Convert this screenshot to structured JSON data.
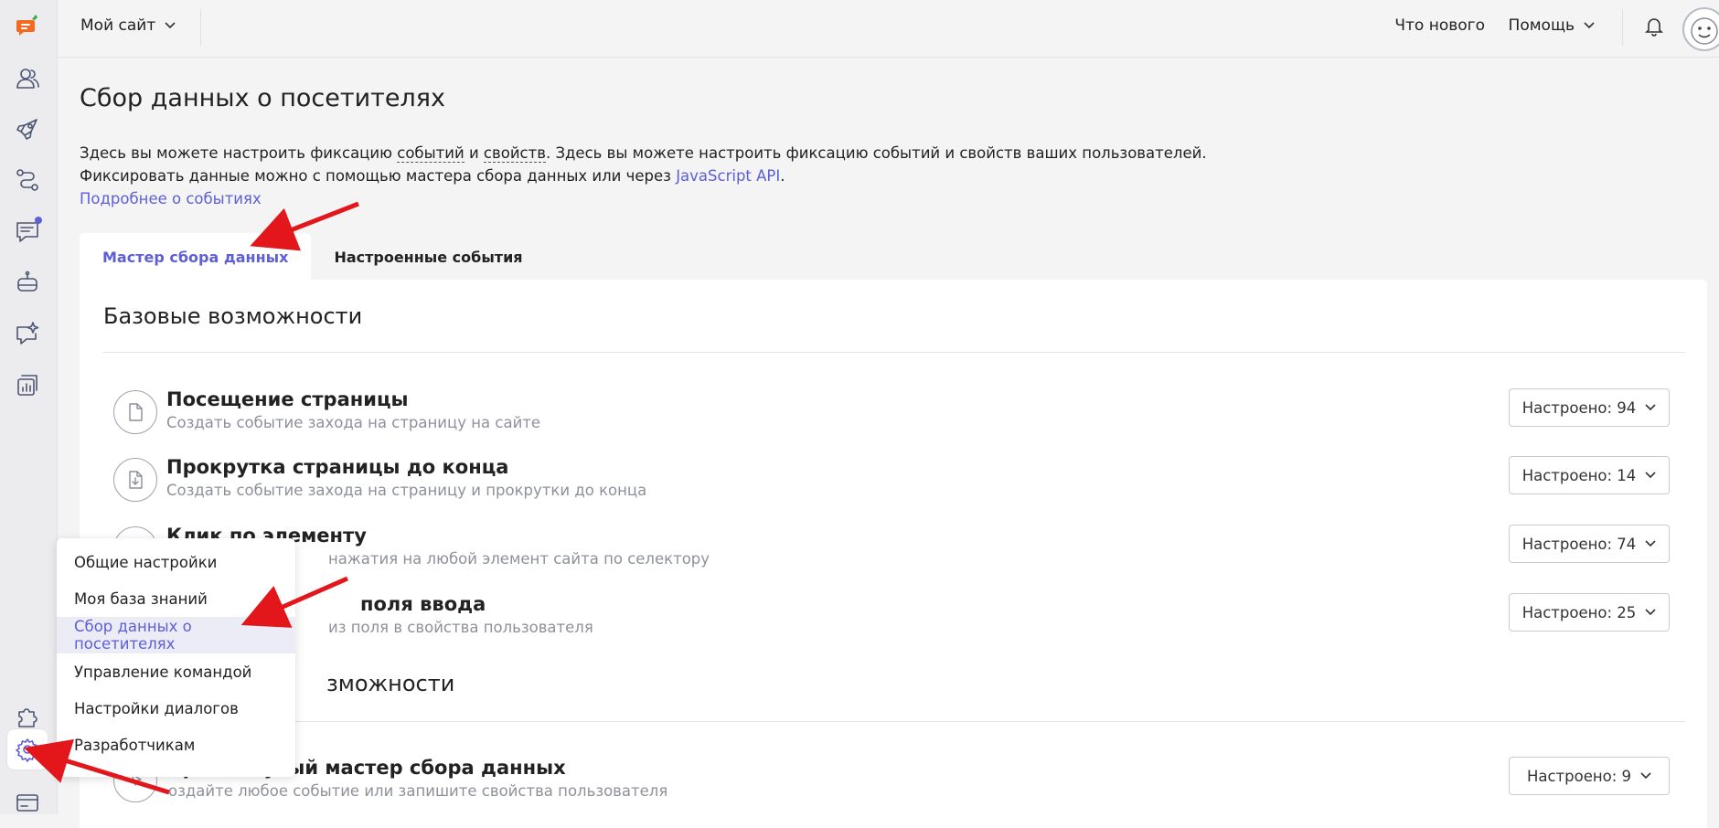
{
  "topbar": {
    "site_select": "Мой сайт",
    "whats_new": "Что нового",
    "help": "Помощь"
  },
  "page": {
    "title": "Сбор данных о посетителях",
    "intro": {
      "line1_a": "Здесь вы можете настроить фиксацию ",
      "events_term": "событий",
      "and": " и ",
      "props_term": "свойств",
      "line1_b": ". Здесь вы можете настроить фиксацию событий и свойств ваших пользователей.",
      "line2_a": "Фиксировать данные можно с помощью мастера сбора данных или через ",
      "js_api": "JavaScript API",
      "line2_b": ".",
      "more_link": "Подробнее о событиях"
    }
  },
  "tabs": [
    {
      "label": "Мастер сбора данных",
      "active": true
    },
    {
      "label": "Настроенные события",
      "active": false
    }
  ],
  "sections": {
    "basic": {
      "title": "Базовые возможности",
      "rows": [
        {
          "title": "Посещение страницы",
          "desc": "Создать событие захода на страницу на сайте",
          "configured": "Настроено: 94"
        },
        {
          "title": "Прокрутка страницы до конца",
          "desc": "Создать событие захода на страницу и прокрутки до конца",
          "configured": "Настроено: 14"
        },
        {
          "title": "Клик по элементу",
          "desc": "нажатия на любой элемент сайта по селектору",
          "configured": "Настроено: 74"
        },
        {
          "title": "поля ввода",
          "desc": "из поля в свойства пользователя",
          "configured": "Настроено: 25"
        }
      ]
    },
    "advanced": {
      "title": "зможности",
      "rows": [
        {
          "title": "Продвинутый мастер сбора данных",
          "desc": "оздайте любое событие или запишите свойства пользователя",
          "configured": "Настроено: 9"
        }
      ]
    }
  },
  "settings_menu": {
    "items": [
      {
        "label": "Общие настройки"
      },
      {
        "label": "Моя база знаний"
      },
      {
        "label": "Сбор данных о посетителях",
        "active": true
      },
      {
        "label": "Управление командой"
      },
      {
        "label": "Настройки диалогов"
      },
      {
        "label": "Разработчикам"
      }
    ]
  },
  "colors": {
    "accent": "#5d5fd6",
    "annotation": "#e3161b",
    "logo": "#f26b21"
  }
}
